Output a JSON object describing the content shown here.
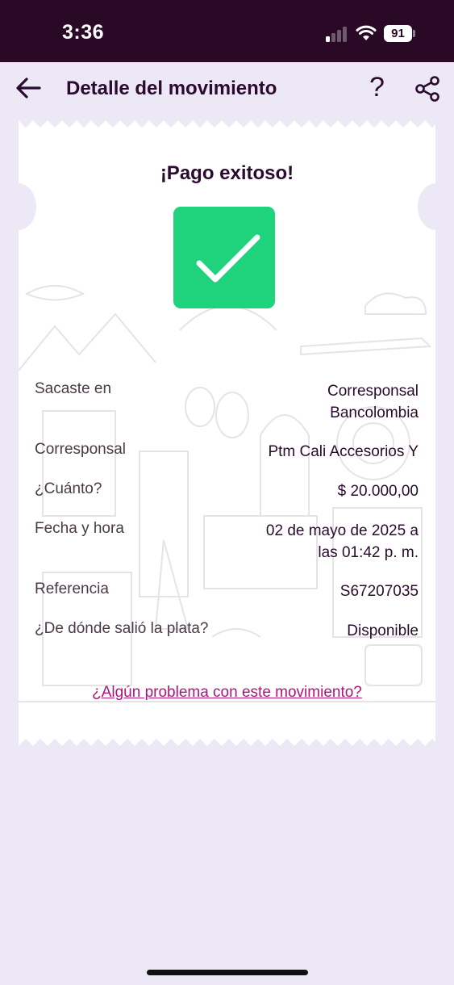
{
  "status_bar": {
    "time": "3:36",
    "battery": "91"
  },
  "header": {
    "title": "Detalle del movimiento",
    "help_label": "?"
  },
  "ticket": {
    "title": "¡Pago exitoso!",
    "status_icon": "check-icon",
    "accent_color": "#1FD27C",
    "rows": [
      {
        "label": "Sacaste en",
        "value_lines": [
          "Corresponsal",
          "Bancolombia"
        ]
      },
      {
        "label": "Corresponsal",
        "value_lines": [
          "Ptm Cali Accesorios Y"
        ]
      },
      {
        "label": "¿Cuánto?",
        "value_lines": [
          "$ 20.000,00"
        ]
      },
      {
        "label": "Fecha y hora",
        "value_lines": [
          "02 de mayo de 2025 a",
          "las 01:42 p. m."
        ]
      },
      {
        "label": "Referencia",
        "value_lines": [
          "S67207035"
        ]
      },
      {
        "label": "¿De dónde salió la plata?",
        "value_lines": [
          "Disponible"
        ]
      }
    ],
    "problem_link": "¿Algún problema con este movimiento?"
  },
  "colors": {
    "status_bar_bg": "#2A0926",
    "page_bg": "#ECE8F6",
    "link": "#B0137A"
  }
}
